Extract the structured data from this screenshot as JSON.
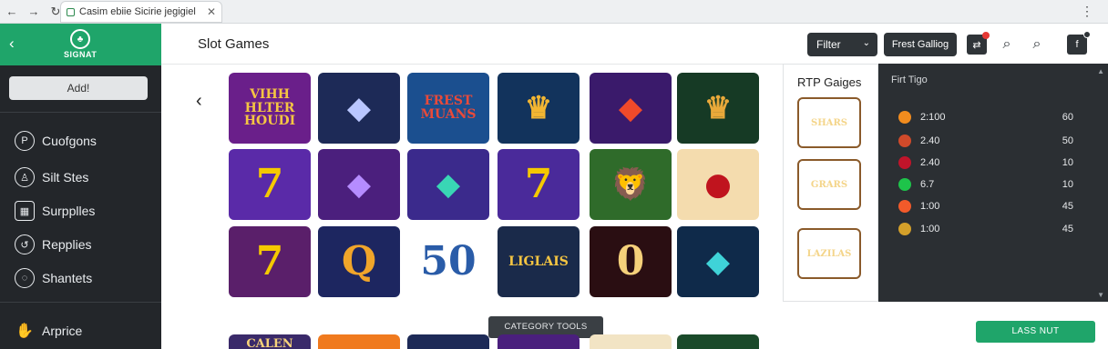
{
  "browser": {
    "tab_title": "Casim ebiie Sicirie jegigiel",
    "close": "✕",
    "back": "←",
    "forward": "→",
    "reload": "↻",
    "menu": "⋮"
  },
  "sidebar": {
    "logo_text": "SIGNAT",
    "add_label": "Add!",
    "items": [
      {
        "label": "Cuofgons",
        "icon": "p-circle-icon",
        "glyph": "P"
      },
      {
        "label": "Silt Stes",
        "icon": "person-icon",
        "glyph": "♙"
      },
      {
        "label": "Surpplles",
        "icon": "grid-icon",
        "glyph": "▦"
      },
      {
        "label": "Repplies",
        "icon": "refresh-circle-icon",
        "glyph": "↺"
      },
      {
        "label": "Shantets",
        "icon": "chat-icon",
        "glyph": "◌"
      },
      {
        "label": "Arprice",
        "icon": "hand-icon",
        "glyph": "✋"
      }
    ]
  },
  "header": {
    "title": "Slot Games",
    "filter_label": "Filter",
    "gallery_label": "Frest Galliog"
  },
  "grid": {
    "prev": "‹",
    "tiles": [
      {
        "text": "VIHH HLTER HOUDI",
        "kind": "text",
        "bg": "#6a1f8a",
        "fg": "#f5c542"
      },
      {
        "text": "◆",
        "kind": "glyph",
        "bg": "#1d2a57",
        "fg": "#b9c6ff"
      },
      {
        "text": "FREST MUANS",
        "kind": "text",
        "bg": "#1b4f8f",
        "fg": "#e84a3a"
      },
      {
        "text": "♛",
        "kind": "glyph",
        "bg": "#12335c",
        "fg": "#f2b632"
      },
      {
        "text": "◆",
        "kind": "glyph",
        "bg": "#3a1a6b",
        "fg": "#f04a2a"
      },
      {
        "text": "♛",
        "kind": "glyph",
        "bg": "#163a25",
        "fg": "#e9a93a"
      },
      {
        "text": "7",
        "kind": "big",
        "bg": "#5a2aa8",
        "fg": "#f5c900"
      },
      {
        "text": "◆",
        "kind": "glyph",
        "bg": "#4b1f7d",
        "fg": "#b58cff"
      },
      {
        "text": "◆",
        "kind": "glyph",
        "bg": "#3b2a8c",
        "fg": "#39d6b5"
      },
      {
        "text": "7",
        "kind": "big",
        "bg": "#4a2a9a",
        "fg": "#f5c900"
      },
      {
        "text": "🦁",
        "kind": "glyph",
        "bg": "#2f6b2a",
        "fg": "#b8632a"
      },
      {
        "text": "●",
        "kind": "glyph",
        "bg": "#f4dcae",
        "fg": "#c0141e"
      },
      {
        "text": "7",
        "kind": "big",
        "bg": "#5a1f6a",
        "fg": "#f5c900"
      },
      {
        "text": "Q",
        "kind": "big",
        "bg": "#1d2660",
        "fg": "#f0a52a"
      },
      {
        "text": "50",
        "kind": "big",
        "bg": "#ffffff",
        "fg": "#2a5ca8"
      },
      {
        "text": "LIGLAIS",
        "kind": "text",
        "bg": "#1a2a4a",
        "fg": "#f5c542"
      },
      {
        "text": "0",
        "kind": "big",
        "bg": "#2a0e12",
        "fg": "#f5d07a"
      },
      {
        "text": "◆",
        "kind": "glyph",
        "bg": "#0f2a4a",
        "fg": "#3fd3d8"
      }
    ]
  },
  "rtp": {
    "title": "RTP Gaiges",
    "gauges": [
      {
        "label": "SHARS",
        "bg": "#3d3320"
      },
      {
        "label": "GRARS",
        "bg": "#2e4a3a"
      },
      {
        "label": "LAZILAS",
        "bg": "#5a1f4a"
      }
    ]
  },
  "list": {
    "title": "Firt Tigo",
    "rows": [
      {
        "odds": "2:100",
        "value": "60",
        "chip": "#f28c1e"
      },
      {
        "odds": "2.40",
        "value": "50",
        "chip": "#d04a2a"
      },
      {
        "odds": "2.40",
        "value": "10",
        "chip": "#c0142a"
      },
      {
        "odds": "6.7",
        "value": "10",
        "chip": "#1ec44a"
      },
      {
        "odds": "1:00",
        "value": "45",
        "chip": "#f25a2a"
      },
      {
        "odds": "1:00",
        "value": "45",
        "chip": "#d4a02a"
      }
    ]
  },
  "footer": {
    "category_tools": "CATEGORY TOOLS",
    "lars_button": "LASS NUT",
    "peek": [
      {
        "text": "CALEN",
        "bg": "#3a2a6a"
      },
      {
        "text": "",
        "bg": "#f07a1e"
      },
      {
        "text": "",
        "bg": "#1d2a57"
      },
      {
        "text": "",
        "bg": "#4a1f7d"
      },
      {
        "text": "",
        "bg": "#f2e4c4"
      },
      {
        "text": "",
        "bg": "#1a4a2a"
      }
    ]
  }
}
